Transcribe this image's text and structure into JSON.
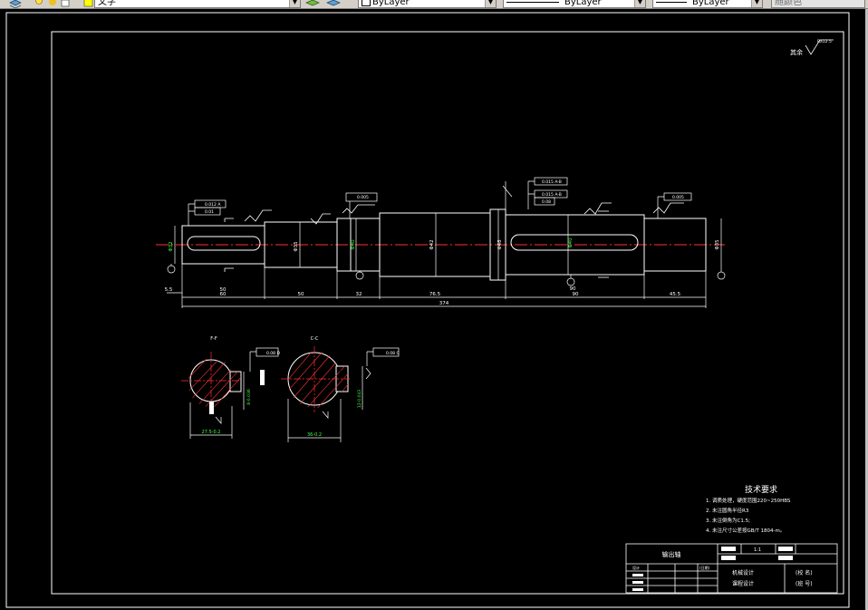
{
  "toolbar": {
    "text_style_value": "文字",
    "layer_value": "ByLayer",
    "linetype_value": "ByLayer",
    "lineweight_value": "ByLayer",
    "plotstyle_value": "随颜色"
  },
  "drawing": {
    "roughness_note_prefix": "其余",
    "roughness_note_value": "Ra12.5",
    "dims": {
      "d_left_end": "5.5",
      "d60": "60",
      "d50_a": "50",
      "d50_b": "50",
      "d32": "32",
      "d765": "76.5",
      "d90_a": "90",
      "d90_b": "90",
      "d455": "45.5",
      "d374": "374"
    },
    "diameters": {
      "dia_left": "Φ32",
      "dia_mid1": "Φ35",
      "dia_mid2": "Φ40",
      "dia_mid3": "Φ42",
      "dia_collar": "Φ48",
      "dia_gear": "Φ40",
      "dia_right": "Φ35"
    },
    "tolerance_frames": {
      "tf1_a": "0.012 A",
      "tf1_b": "0.01",
      "tf2": "0.005",
      "tf3_a": "0.015 A-B",
      "tf3_b": "0.015 A-B",
      "tf3_c": "0.08",
      "tf4": "0.005",
      "tf5": "0.08 D",
      "tf6": "0.08 C"
    },
    "section_labels": {
      "left": "F-F",
      "right": "C-C"
    },
    "section_dims": {
      "left_width": "27.5-0.2",
      "left_key": "8-0.036",
      "right_width": "36-0.2",
      "right_key": "12-0.043"
    },
    "tech_req": {
      "title": "技术要求",
      "items": [
        "1. 调质处理，硬度范围220~250HBS",
        "2. 未注圆角半径R3",
        "3. 未注倒角为C1.5;",
        "4. 未注尺寸公差按GB/T 1804-m。"
      ]
    },
    "title_block": {
      "part_name": "输出轴",
      "scale_label": "比例",
      "row_label_1": "设计",
      "row_label_2": "审核",
      "date_label": "(日期)",
      "course_1": "机械设计",
      "course_2": "课程设计",
      "school": "(校 名)",
      "class_no": "(班 号)",
      "ratio": "1:1"
    }
  }
}
